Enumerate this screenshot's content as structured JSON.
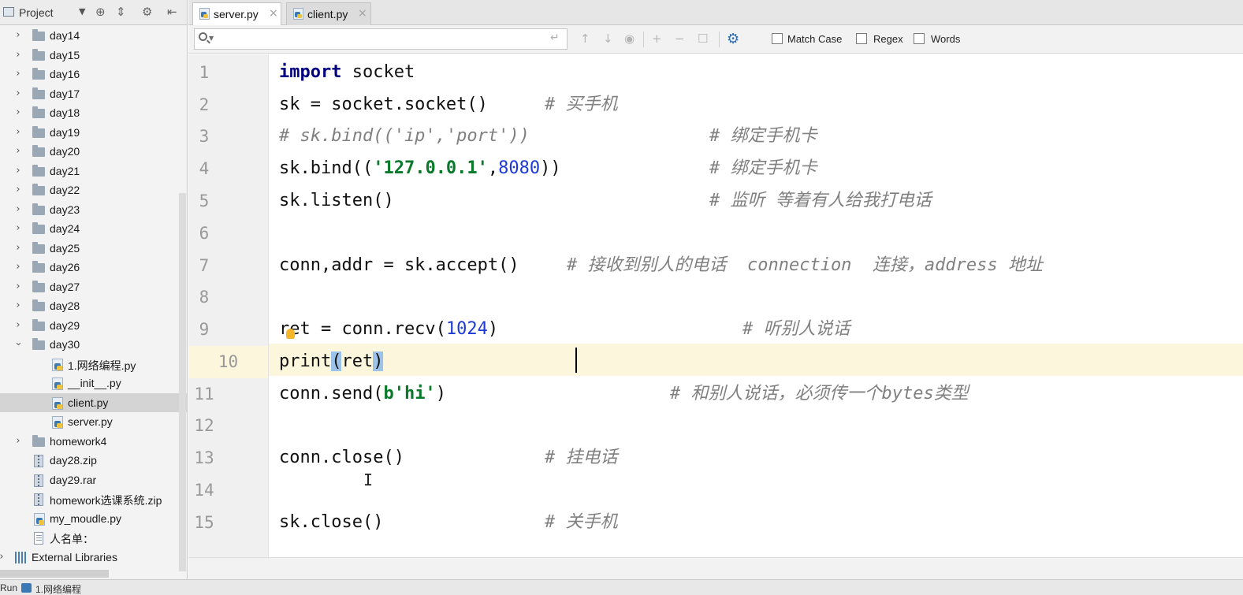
{
  "project_panel": {
    "title": "Project",
    "tree": [
      {
        "label": "day14",
        "type": "folder",
        "expanded": false
      },
      {
        "label": "day15",
        "type": "folder",
        "expanded": false
      },
      {
        "label": "day16",
        "type": "folder",
        "expanded": false
      },
      {
        "label": "day17",
        "type": "folder",
        "expanded": false
      },
      {
        "label": "day18",
        "type": "folder",
        "expanded": false
      },
      {
        "label": "day19",
        "type": "folder",
        "expanded": false
      },
      {
        "label": "day20",
        "type": "folder",
        "expanded": false
      },
      {
        "label": "day21",
        "type": "folder",
        "expanded": false
      },
      {
        "label": "day22",
        "type": "folder",
        "expanded": false
      },
      {
        "label": "day23",
        "type": "folder",
        "expanded": false
      },
      {
        "label": "day24",
        "type": "folder",
        "expanded": false
      },
      {
        "label": "day25",
        "type": "folder",
        "expanded": false
      },
      {
        "label": "day26",
        "type": "folder",
        "expanded": false
      },
      {
        "label": "day27",
        "type": "folder",
        "expanded": false
      },
      {
        "label": "day28",
        "type": "folder",
        "expanded": false
      },
      {
        "label": "day29",
        "type": "folder",
        "expanded": false
      },
      {
        "label": "day30",
        "type": "folder",
        "expanded": true
      },
      {
        "label": "1.网络编程.py",
        "type": "python-file"
      },
      {
        "label": "__init__.py",
        "type": "python-file"
      },
      {
        "label": "client.py",
        "type": "python-file",
        "selected": true
      },
      {
        "label": "server.py",
        "type": "python-file"
      },
      {
        "label": "homework4",
        "type": "folder",
        "expanded": false
      },
      {
        "label": "day28.zip",
        "type": "archive"
      },
      {
        "label": "day29.rar",
        "type": "archive"
      },
      {
        "label": "homework选课系统.zip",
        "type": "archive"
      },
      {
        "label": "my_moudle.py",
        "type": "python-file"
      },
      {
        "label": "人名单：",
        "type": "text-file"
      },
      {
        "label": "External Libraries",
        "type": "libraries"
      }
    ]
  },
  "tabs": [
    {
      "label": "server.py",
      "active": true
    },
    {
      "label": "client.py",
      "active": false
    }
  ],
  "search": {
    "value": "",
    "placeholder": "",
    "options": {
      "match_case": "Match Case",
      "regex": "Regex",
      "words": "Words"
    }
  },
  "editor": {
    "current_line": 10,
    "line_numbers": [
      "1",
      "2",
      "3",
      "4",
      "5",
      "6",
      "7",
      "8",
      "9",
      "10",
      "11",
      "12",
      "13",
      "14",
      "15"
    ],
    "code": {
      "l1_kw": "import",
      "l1_rest": " socket",
      "l2": "sk = socket.socket()",
      "l2_comment": "# 买手机",
      "l3": "# sk.bind(('ip','port'))",
      "l3_comment": "# 绑定手机卡",
      "l4_a": "sk.bind((",
      "l4_str": "'127.0.0.1'",
      "l4_comma": ",",
      "l4_num": "8080",
      "l4_b": "))",
      "l4_comment": "# 绑定手机卡",
      "l5": "sk.listen()",
      "l5_comment": "# 监听 等着有人给我打电话",
      "l7": "conn,addr = sk.accept()",
      "l7_comment": "# 接收到别人的电话  connection  连接，address 地址",
      "l9_a": "ret = conn.recv(",
      "l9_num": "1024",
      "l9_b": ")",
      "l9_comment": "# 听别人说话",
      "l10_a": "print",
      "l10_paren_open": "(",
      "l10_b": "ret",
      "l10_paren_close": ")",
      "l11_a": "conn.send(",
      "l11_str": "b'hi'",
      "l11_b": ")",
      "l11_comment": "# 和别人说话，必须传一个bytes类型",
      "l13": "conn.close()",
      "l13_comment": "# 挂电话",
      "l15": "sk.close()",
      "l15_comment": "# 关手机"
    }
  },
  "status": {
    "run_label": "Run",
    "run_target": "1.网络编程"
  },
  "colors": {
    "keyword": "#000080",
    "number": "#1d39d8",
    "string": "#0a7a2a",
    "comment": "#808080",
    "current_line": "#fcf7dc",
    "brace_highlight": "#9cc2ea"
  }
}
